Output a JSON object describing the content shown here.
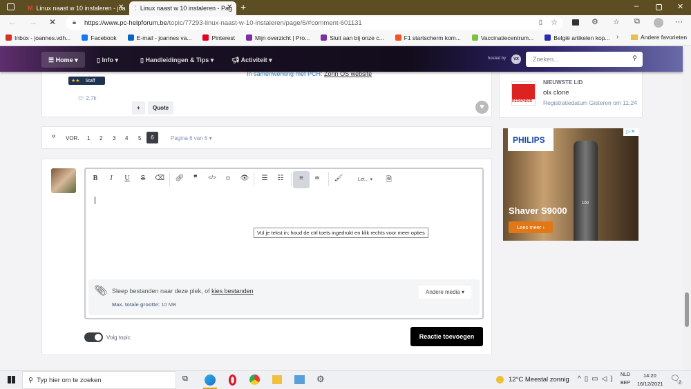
{
  "browser": {
    "tabs": [
      {
        "label": "Linux naast w 10 instaleren - joa"
      },
      {
        "label": "Linux naast w 10 instaleren - Pag"
      }
    ],
    "url_domain": "https://www.pc-helpforum.be",
    "url_path": "/topic/77293-linux-naast-w-10-instaleren/page/6/#comment-601131",
    "bookmarks": [
      {
        "label": "Inbox - joannes.vdh...",
        "color": "#d93025"
      },
      {
        "label": "Facebook",
        "color": "#1877f2"
      },
      {
        "label": "E-mail - joannes va...",
        "color": "#0a64c8"
      },
      {
        "label": "Pinterest",
        "color": "#e60023"
      },
      {
        "label": "Mijn overzicht | Pro...",
        "color": "#7b2fa8"
      },
      {
        "label": "Sluit aan bij onze c...",
        "color": "#7b2fa8"
      },
      {
        "label": "F1 startscherm kom...",
        "color": "#f35325"
      },
      {
        "label": "Vaccinatiecentrum...",
        "color": "#7cc242"
      },
      {
        "label": "België artikelen kop...",
        "color": "#2b2bb0"
      }
    ],
    "other_favorites": "Andere favorieten"
  },
  "nav": {
    "items": [
      {
        "label": "Home"
      },
      {
        "label": "Info"
      },
      {
        "label": "Handleidingen & Tips"
      },
      {
        "label": "Activiteit"
      }
    ],
    "hosted_by": "hosted by",
    "search_placeholder": "Zoeken..."
  },
  "post": {
    "signature_prefix": "In samenwerking met PCH:",
    "signature_link": "Zorin OS website",
    "badge": "Staff",
    "badge_stars": "★★",
    "posts_count": "2,7k",
    "plus": "+",
    "quote": "Quote"
  },
  "pagination": {
    "first": "«",
    "prev": "VOR.",
    "pages": [
      "1",
      "2",
      "3",
      "4",
      "5",
      "6"
    ],
    "current": "6",
    "page_label": "Pagina 6 van 6"
  },
  "editor": {
    "font_label": "Let...",
    "tooltip": "Vul je tekst in; houd de ctrl toets ingedrukt en klik rechts voor meer opties",
    "attach_text": "Sleep bestanden naar deze plek, of",
    "attach_link": "kies bestanden",
    "max_label": "Max. totale grootte:",
    "max_value": "10 MB",
    "other_media": "Andere media",
    "follow": "Volg topic",
    "submit": "Reactie toevoegen"
  },
  "sidebar": {
    "newest_title": "NIEUWSTE LID",
    "member_name": "olx clone",
    "reg": "Registratiedatum Gisteren om 11:24",
    "logo_text": "REDSPIDER"
  },
  "ad": {
    "brand": "PHILIPS",
    "product": "Shaver S9000",
    "cta": "Lees meer ›",
    "display": "100"
  },
  "taskbar": {
    "search": "Typ hier om te zoeken",
    "weather": "12°C  Meestal zonnig",
    "lang1": "NLD",
    "lang2": "BEP",
    "time": "14:20",
    "date": "16/12/2021",
    "notif": "2"
  }
}
